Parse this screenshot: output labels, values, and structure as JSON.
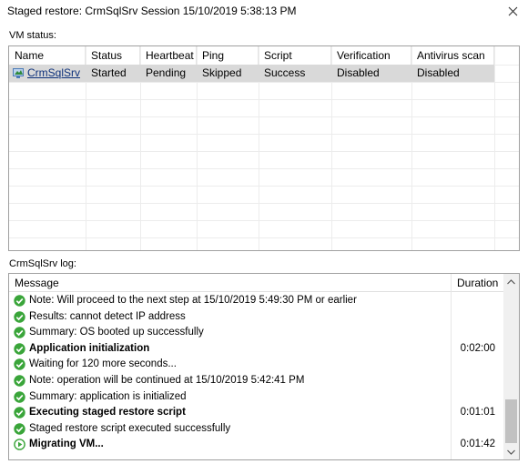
{
  "window": {
    "title": "Staged restore: CrmSqlSrv Session 15/10/2019 5:38:13 PM",
    "close_glyph": "✕"
  },
  "vm_status": {
    "label": "VM status:",
    "columns": [
      "Name",
      "Status",
      "Heartbeat",
      "Ping",
      "Script",
      "Verification",
      "Antivirus scan"
    ],
    "rows": [
      {
        "name": "CrmSqlSrv",
        "status": "Started",
        "heartbeat": "Pending",
        "ping": "Skipped",
        "script": "Success",
        "verification": "Disabled",
        "antivirus": "Disabled",
        "icon": "vm-icon"
      }
    ]
  },
  "log": {
    "label": "CrmSqlSrv log:",
    "columns": {
      "message": "Message",
      "duration": "Duration"
    },
    "rows": [
      {
        "icon": "success-check-icon",
        "text": "Note: Will proceed to the next step at 15/10/2019 5:49:30 PM or earlier",
        "bold": false,
        "duration": ""
      },
      {
        "icon": "success-check-icon",
        "text": "Results: cannot detect IP address",
        "bold": false,
        "duration": ""
      },
      {
        "icon": "success-check-icon",
        "text": "Summary: OS booted up successfully",
        "bold": false,
        "duration": ""
      },
      {
        "icon": "success-check-icon",
        "text": "Application initialization",
        "bold": true,
        "duration": "0:02:00"
      },
      {
        "icon": "success-check-icon",
        "text": "Waiting for 120 more seconds...",
        "bold": false,
        "duration": ""
      },
      {
        "icon": "success-check-icon",
        "text": "Note: operation will be continued at 15/10/2019 5:42:41 PM",
        "bold": false,
        "duration": ""
      },
      {
        "icon": "success-check-icon",
        "text": "Summary: application is initialized",
        "bold": false,
        "duration": ""
      },
      {
        "icon": "success-check-icon",
        "text": "Executing staged restore script",
        "bold": true,
        "duration": "0:01:01"
      },
      {
        "icon": "success-check-icon",
        "text": "Staged restore script executed successfully",
        "bold": false,
        "duration": ""
      },
      {
        "icon": "in-progress-play-icon",
        "text": "Migrating VM...",
        "bold": true,
        "duration": "0:01:42"
      }
    ]
  },
  "colors": {
    "success_green": "#3aa53a",
    "selected_row": "#d9d9d9",
    "link_blue": "#0b2f7a"
  }
}
